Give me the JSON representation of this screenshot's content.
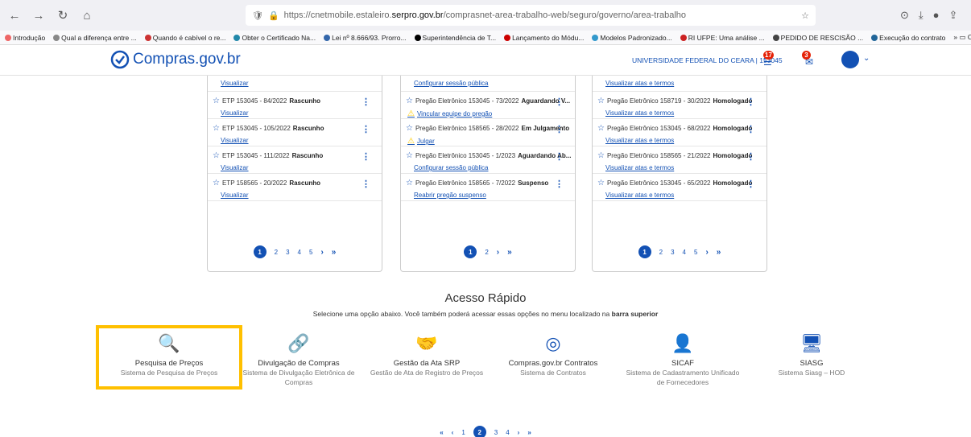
{
  "browser": {
    "url_prefix": "https://cnetmobile.estaleiro.",
    "url_domain": "serpro.gov.br",
    "url_path": "/comprasnet-area-trabalho-web/seguro/governo/area-trabalho",
    "bookmarks": [
      "Introdução",
      "Qual a diferença entre ...",
      "Quando é cabível o re...",
      "Obter o Certificado Na...",
      "Lei nº 8.666/93. Prorro...",
      "Superintendência de T...",
      "Lançamento do Módu...",
      "Modelos Padronizado...",
      "RI UFPE: Uma análise ...",
      "PEDIDO DE RESCISÃO ...",
      "Execução do contrato"
    ],
    "other_bookmarks": "Outros favoritos"
  },
  "header": {
    "logo": "Compras.gov.br",
    "org": "UNIVERSIDADE FEDERAL DO CEARA | 153045",
    "notif_count": "17",
    "msg_count": "3"
  },
  "cards": [
    {
      "first_link": "Visualizar",
      "rows": [
        {
          "title": "ETP 153045 - 84/2022",
          "status": "Rascunho",
          "link": "Visualizar",
          "warn": false
        },
        {
          "title": "ETP 153045 - 105/2022",
          "status": "Rascunho",
          "link": "Visualizar",
          "warn": false
        },
        {
          "title": "ETP 153045 - 111/2022",
          "status": "Rascunho",
          "link": "Visualizar",
          "warn": false
        },
        {
          "title": "ETP 158565 - 20/2022",
          "status": "Rascunho",
          "link": "Visualizar",
          "warn": false
        }
      ],
      "pages": [
        "1",
        "2",
        "3",
        "4",
        "5"
      ]
    },
    {
      "first_link": "Configurar sessão pública",
      "rows": [
        {
          "title": "Pregão Eletrônico 153045 - 73/2022",
          "status": "Aguardando V...",
          "link": "Vincular equipe do pregão",
          "warn": true
        },
        {
          "title": "Pregão Eletrônico 158565 - 28/2022",
          "status": "Em Julgamento",
          "link": "Julgar",
          "warn": true
        },
        {
          "title": "Pregão Eletrônico 153045 - 1/2023",
          "status": "Aguardando Ab...",
          "link": "Configurar sessão pública",
          "warn": false
        },
        {
          "title": "Pregão Eletrônico 158565 - 7/2022",
          "status": "Suspenso",
          "link": "Reabrir pregão suspenso",
          "warn": false
        }
      ],
      "pages": [
        "1",
        "2"
      ]
    },
    {
      "first_link": "Visualizar atas e termos",
      "rows": [
        {
          "title": "Pregão Eletrônico 158719 - 30/2022",
          "status": "Homologado",
          "link": "Visualizar atas e termos",
          "warn": false
        },
        {
          "title": "Pregão Eletrônico 153045 - 68/2022",
          "status": "Homologado",
          "link": "Visualizar atas e termos",
          "warn": false
        },
        {
          "title": "Pregão Eletrônico 158565 - 21/2022",
          "status": "Homologado",
          "link": "Visualizar atas e termos",
          "warn": false
        },
        {
          "title": "Pregão Eletrônico 153045 - 65/2022",
          "status": "Homologado",
          "link": "Visualizar atas e termos",
          "warn": false
        }
      ],
      "pages": [
        "1",
        "2",
        "3",
        "4",
        "5"
      ]
    }
  ],
  "quick": {
    "title": "Acesso Rápido",
    "subtitle_pre": "Selecione uma opção abaixo. Você também poderá acessar essas opções no menu localizado na ",
    "subtitle_bold": "barra superior",
    "items": [
      {
        "title": "Pesquisa de Preços",
        "sub": "Sistema de Pesquisa de Preços",
        "icon": "search-dollar-icon"
      },
      {
        "title": "Divulgação de Compras",
        "sub": "Sistema de Divulgação Eletrônica de Compras",
        "icon": "link-icon"
      },
      {
        "title": "Gestão da Ata SRP",
        "sub": "Gestão de Ata de Registro de Preços",
        "icon": "handshake-icon"
      },
      {
        "title": "Compras.gov.br Contratos",
        "sub": "Sistema de Contratos",
        "icon": "compras-logo-icon"
      },
      {
        "title": "SICAF",
        "sub": "Sistema de Cadastramento Unificado de Fornecedores",
        "icon": "person-icon"
      },
      {
        "title": "SIASG",
        "sub": "Sistema Siasg – HOD",
        "icon": "computer-icon"
      }
    ]
  },
  "bottom_pages": [
    "1",
    "2",
    "3",
    "4"
  ]
}
